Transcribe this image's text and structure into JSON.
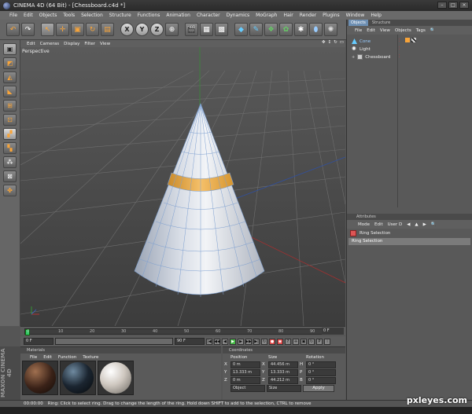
{
  "window": {
    "title": "CINEMA 4D (64 Bit) - [Chessboard.c4d *]"
  },
  "menu": [
    "File",
    "Edit",
    "Objects",
    "Tools",
    "Selection",
    "Structure",
    "Functions",
    "Animation",
    "Character",
    "Dynamics",
    "MoGraph",
    "Hair",
    "Render",
    "Plugins",
    "Window",
    "Help"
  ],
  "toolbar": {
    "axis_x": "X",
    "axis_y": "Y",
    "axis_z": "Z"
  },
  "viewport": {
    "menu": [
      "Edit",
      "Cameras",
      "Display",
      "Filter",
      "View"
    ],
    "label": "Perspective"
  },
  "timeline": {
    "ticks": [
      "0",
      "10",
      "20",
      "30",
      "40",
      "50",
      "60",
      "70",
      "80",
      "90"
    ],
    "end_field": "0 F"
  },
  "playbar": {
    "start_field": "0 F",
    "end_field": "90 F"
  },
  "materials": {
    "tab": "Materials",
    "menu": [
      "File",
      "Edit",
      "Function",
      "Texture"
    ]
  },
  "brand": "MAXON CINEMA 4D",
  "coordinates": {
    "tab": "Coordinates",
    "headers": [
      "Position",
      "Size",
      "Rotation"
    ],
    "rows": [
      {
        "axis": "X",
        "pos": "0 m",
        "size": "44.456 m",
        "rot_label": "H",
        "rot": "0 °"
      },
      {
        "axis": "Y",
        "pos": "13.333 m",
        "size": "13.333 m",
        "rot_label": "P",
        "rot": "0 °"
      },
      {
        "axis": "Z",
        "pos": "0 m",
        "size": "44.212 m",
        "rot_label": "B",
        "rot": "0 °"
      }
    ],
    "mode_object": "Object",
    "mode_size": "Size",
    "apply": "Apply"
  },
  "status": {
    "time": "00:00:00",
    "message": "Ring: Click to select ring. Drag to change the length of the ring. Hold down SHIFT to add to the selection, CTRL to remove"
  },
  "objects_panel": {
    "tabs": [
      "Objects",
      "Structure"
    ],
    "menu": [
      "File",
      "Edit",
      "View",
      "Objects",
      "Tags"
    ],
    "items": [
      {
        "name": "Cone",
        "selected": true
      },
      {
        "name": "Light",
        "selected": false
      },
      {
        "name": "Chessboard",
        "selected": false
      }
    ]
  },
  "attributes_panel": {
    "tab": "Attributes",
    "menu": [
      "Mode",
      "Edit",
      "User D"
    ],
    "title": "Ring Selection",
    "section": "Ring Selection"
  },
  "watermark": "pxleyes.com",
  "colors": {
    "selection_orange": "#f2a93b",
    "accent_blue": "#6d8fb3"
  }
}
